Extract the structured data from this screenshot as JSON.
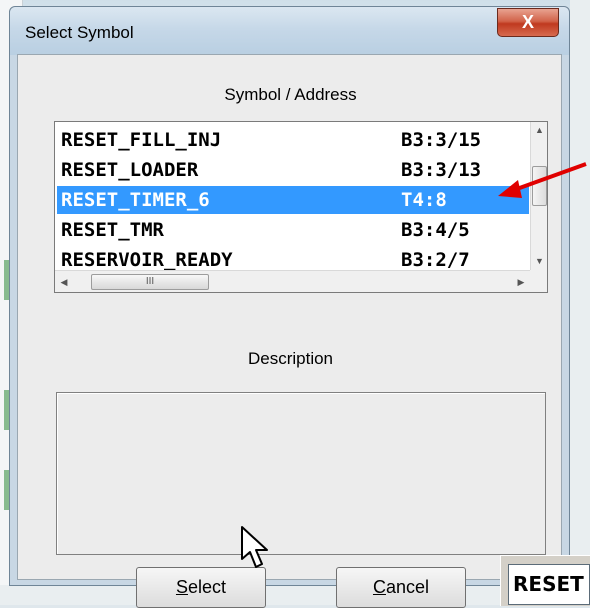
{
  "dialog": {
    "title": "Select Symbol",
    "close_label": "X",
    "symbol_header": "Symbol  /  Address",
    "description_header": "Description",
    "select_button": {
      "accel": "S",
      "rest": "elect"
    },
    "cancel_button": {
      "accel": "C",
      "rest": "ancel"
    }
  },
  "symbol_list": {
    "rows": [
      {
        "symbol": "RESET_FILL_INJ",
        "address": "B3:3/15",
        "selected": false
      },
      {
        "symbol": "RESET_LOADER",
        "address": "B3:3/13",
        "selected": false
      },
      {
        "symbol": "RESET_TIMER_6",
        "address": "T4:8",
        "selected": true
      },
      {
        "symbol": "RESET_TMR",
        "address": "B3:4/5",
        "selected": false
      },
      {
        "symbol": "RESERVOIR_READY",
        "address": "B3:2/7",
        "selected": false
      }
    ],
    "h_thumb_grip": "III"
  },
  "background": {
    "peek_field_text": "RESET"
  },
  "colors": {
    "selection": "#3399ff",
    "annotation_arrow": "#e00000",
    "close_button": "#c0391f"
  },
  "icons": [
    "close-icon",
    "scroll-up-icon",
    "scroll-down-icon",
    "scroll-left-icon",
    "scroll-right-icon",
    "arrow-annotation-icon",
    "mouse-cursor-icon"
  ]
}
